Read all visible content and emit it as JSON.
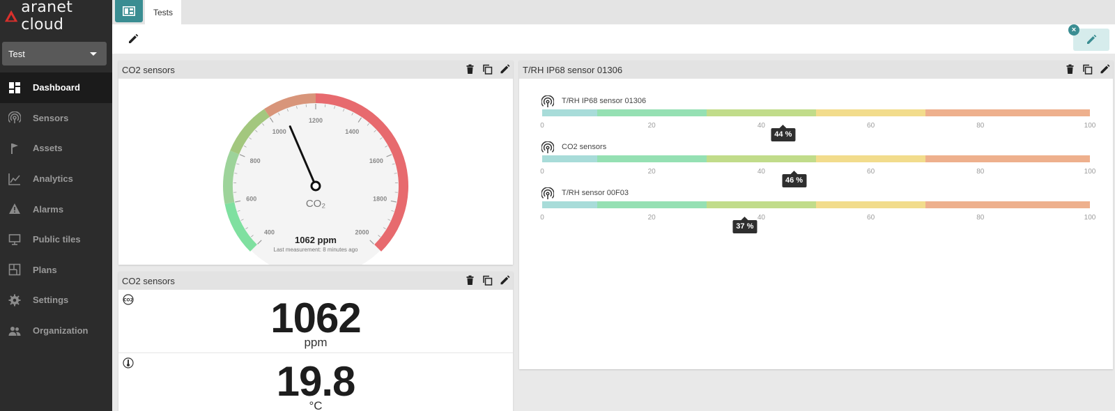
{
  "app": {
    "brand": "aranet cloud",
    "brand_color": "#d9302c",
    "accent_color": "#3a8d92"
  },
  "sidebar": {
    "organization": "Test",
    "items": [
      {
        "label": "Dashboard",
        "icon": "dashboard-icon",
        "active": true
      },
      {
        "label": "Sensors",
        "icon": "sensor-icon",
        "active": false
      },
      {
        "label": "Assets",
        "icon": "flag-icon",
        "active": false
      },
      {
        "label": "Analytics",
        "icon": "chart-line-icon",
        "active": false
      },
      {
        "label": "Alarms",
        "icon": "warning-icon",
        "active": false
      },
      {
        "label": "Public tiles",
        "icon": "monitor-icon",
        "active": false
      },
      {
        "label": "Plans",
        "icon": "floor-plan-icon",
        "active": false
      },
      {
        "label": "Settings",
        "icon": "gear-icon",
        "active": false
      },
      {
        "label": "Organization",
        "icon": "people-icon",
        "active": false
      }
    ]
  },
  "tabs": {
    "active_tab": "Tests"
  },
  "widgets": {
    "gauge": {
      "title": "CO2 sensors",
      "label": "CO₂",
      "value": 1062,
      "value_text": "1062 ppm",
      "last_measurement": "Last measurement: 8 minutes ago",
      "min": 400,
      "max": 2000,
      "ticks": [
        "400",
        "600",
        "800",
        "1000",
        "1200",
        "1400",
        "1600",
        "1800",
        "2000"
      ]
    },
    "readings": {
      "title": "CO2 sensors",
      "co2": {
        "value": "1062",
        "unit": "ppm",
        "icon": "co2-icon"
      },
      "temperature": {
        "value": "19.8",
        "unit": "°C",
        "icon": "thermometer-icon"
      }
    },
    "humidity": {
      "title": "T/RH IP68 sensor 01306",
      "ticks": [
        "0",
        "20",
        "40",
        "60",
        "80",
        "100"
      ],
      "segments": [
        {
          "to": 10,
          "color": "#a8dcd9"
        },
        {
          "to": 30,
          "color": "#95e0b3"
        },
        {
          "to": 50,
          "color": "#c1dc8a"
        },
        {
          "to": 70,
          "color": "#f2dc8c"
        },
        {
          "to": 100,
          "color": "#eeb08d"
        }
      ],
      "rows": [
        {
          "name": "T/RH IP68 sensor 01306",
          "value": 44,
          "badge": "44 %"
        },
        {
          "name": "CO2 sensors",
          "value": 46,
          "badge": "46 %"
        },
        {
          "name": "T/RH sensor 00F03",
          "value": 37,
          "badge": "37 %"
        }
      ]
    }
  }
}
